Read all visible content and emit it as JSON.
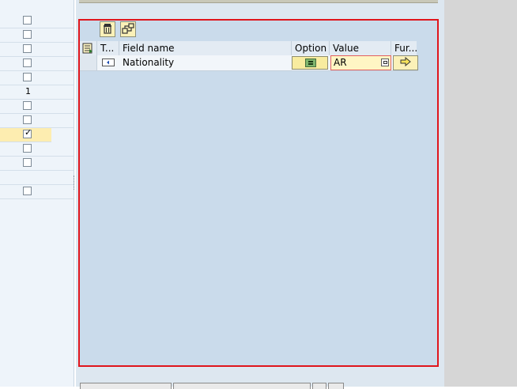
{
  "left_panel": {
    "rows": [
      {
        "type": "checkbox",
        "checked": false
      },
      {
        "type": "checkbox",
        "checked": false
      },
      {
        "type": "checkbox",
        "checked": false
      },
      {
        "type": "checkbox",
        "checked": false
      },
      {
        "type": "checkbox",
        "checked": false
      },
      {
        "type": "number",
        "value": "1"
      },
      {
        "type": "checkbox",
        "checked": false
      },
      {
        "type": "checkbox",
        "checked": false
      },
      {
        "type": "checkbox",
        "checked": true
      },
      {
        "type": "checkbox",
        "checked": false
      },
      {
        "type": "checkbox",
        "checked": false
      },
      {
        "type": "checkbox",
        "checked": false
      }
    ],
    "check_glyph": "✓"
  },
  "toolbar": {
    "delete_icon": "trash-icon",
    "condition_icon": "flowchart-icon"
  },
  "table": {
    "headers": {
      "type": "T...",
      "field_name": "Field name",
      "option": "Option",
      "value": "Value",
      "function": "Fur..."
    },
    "rows": [
      {
        "type_icon": "field-type-icon",
        "field_name": "Nationality",
        "option": "equals",
        "value": "AR",
        "value_help_icon": "f4-help-icon",
        "function_icon": "arrow-right-icon"
      }
    ]
  },
  "colors": {
    "frame_border": "#e0151c",
    "panel_bg": "#cadbeb",
    "yellow_button": "#fbf1b8",
    "highlight_row": "#fdedb0"
  }
}
